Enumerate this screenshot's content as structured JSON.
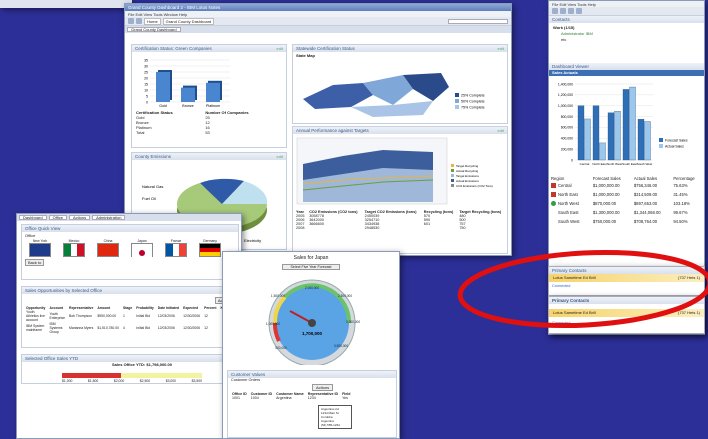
{
  "win_main": {
    "title": "Grand County Dashboard 2 - IBM Lotus Notes",
    "menu": "File  Edit  View  Tools  Window  Help",
    "tabs": [
      "Home",
      "Grand County Dashboard"
    ],
    "dashboard_tab": "Grand County Dashboard",
    "cert": {
      "title": "Certification Status: Green Companies",
      "edit": "edit",
      "col1": "Certification Status",
      "col2": "Number Of Companies",
      "rows": [
        [
          "Gold",
          "25"
        ],
        [
          "Bronze",
          "12"
        ],
        [
          "Platinum",
          "16"
        ],
        [
          "Total",
          "53"
        ]
      ],
      "chart": {
        "type": "bar",
        "categories": [
          "Gold",
          "Bronze",
          "Platinum"
        ],
        "values": [
          25,
          12,
          16
        ],
        "ylim": [
          0,
          35
        ],
        "yticks": [
          "0",
          "5",
          "10",
          "15",
          "20",
          "25",
          "30",
          "35"
        ]
      }
    },
    "state": {
      "title": "Statewide Certification Status",
      "edit": "edit",
      "map_label": "State Map",
      "legend": [
        "25% Complete",
        "50% Complete",
        "75% Complete"
      ]
    },
    "emissions": {
      "title": "County Emissions",
      "edit": "edit",
      "slices": [
        "Natural Gas",
        "Fuel Oil",
        "Electricity"
      ]
    },
    "targets": {
      "title": "Annual Performance against Targets",
      "edit": "edit",
      "legend": [
        "Target Recycling",
        "Actual Recycling",
        "Target Emissions",
        "Actual Emissions",
        "CO2 Emissions (CO2 Tons)"
      ],
      "cols": [
        "Year",
        "CO2 Emissions (CO2 tons)",
        "Target CO2 Emissions (tons)",
        "Recycling (tons)",
        "Target Recycling (tons)"
      ],
      "rows": [
        [
          "2005",
          "3058778",
          "2450039",
          "570",
          "480"
        ],
        [
          "2006",
          "3642000",
          "3254710",
          "590",
          "500"
        ],
        [
          "2007",
          "3666600",
          "3434938",
          "601",
          "757"
        ],
        [
          "2008",
          "",
          "2948530",
          "",
          "750"
        ]
      ]
    }
  },
  "win_left": {
    "tabs": [
      "Dashboard",
      "Office",
      "Actions",
      "Administration"
    ],
    "office": {
      "title": "Office Quick View",
      "label": "Office",
      "flags": [
        "New York",
        "Mexico",
        "China",
        "Japan",
        "France",
        "Germany"
      ],
      "button": "Back to"
    },
    "opps": {
      "title": "Sales Opportunities by Selected Office",
      "actions": "Actions",
      "cols": [
        "Opportunity",
        "Account",
        "Representative",
        "Amount",
        "Stage",
        "Probability",
        "Date Initiated",
        "Expected",
        "Percent",
        "Key Rank"
      ],
      "rows": [
        [
          "Youth Athletics live account",
          "Youth Enterprise",
          "Bob Thompson",
          "$950,000.00",
          "1",
          "Initial Bid",
          "12/03/2006",
          "12/30/2006",
          "12",
          ""
        ],
        [
          "IBM System mainframe",
          "IBM Systems Group",
          "Marianna Myers",
          "$1,510,780.00",
          "4",
          "Initial Bid",
          "12/03/2006",
          "12/30/2006",
          "12",
          ""
        ]
      ]
    },
    "selected": {
      "title": "Selected Office Sales YTD",
      "bar_title": "Sales Office YTD: $1,798,000.00",
      "scale": [
        "$1,000",
        "$1,500",
        "$2,000",
        "$2,500",
        "$3,000",
        "$3,500"
      ]
    }
  },
  "win_gauge": {
    "title": "Sales for Japan",
    "button": "Select Five Year Forecast",
    "value": "1,700,000",
    "ticks": [
      "2,000,000",
      "2,500,000",
      "3,000,000",
      "3,500,000",
      "1,500,000",
      "1,000,000",
      "500,000"
    ],
    "customer": {
      "title": "Customer Values",
      "subtitle": "Customer Orders",
      "actions": "Actions",
      "cols": [
        "Office ID",
        "Customer ID",
        "Customer Name",
        "Representative ID",
        "Field"
      ],
      "row": [
        "1001",
        "1004",
        "Argentina",
        "1234",
        "Yes"
      ],
      "popup": [
        "Argentina Ltd",
        "1234 Main St",
        "Cordoba",
        "Argentina",
        "(54) 555-1234"
      ]
    }
  },
  "win_right": {
    "menu": "File  Edit  View  Tools  Help",
    "contacts": {
      "title": "Contacts",
      "item": "Work (1/15)",
      "sub": "Administrator IBM",
      "sub2": "etc"
    },
    "viewer": {
      "title": "Dashboard Viewer",
      "panel": "Sales Actuals"
    },
    "chart_data": {
      "type": "bar",
      "categories": [
        "Central",
        "North East",
        "North West",
        "South East",
        "South West"
      ],
      "series": [
        {
          "name": "Forecast Sales",
          "values": [
            1000000,
            1000000,
            870000,
            1300000,
            750000
          ]
        },
        {
          "name": "Actual Sales",
          "values": [
            756346,
            314509,
            897653,
            1344068,
            708764
          ]
        }
      ],
      "ylim": [
        0,
        1400000
      ],
      "yticks": [
        "0",
        "200,000",
        "400,000",
        "600,000",
        "800,000",
        "1,000,000",
        "1,200,000",
        "1,400,000"
      ]
    },
    "table": {
      "cols": [
        "Region",
        "Forecast Sales",
        "Actual Sales",
        "Percentage"
      ],
      "rows": [
        [
          "Central",
          "$1,000,000.00",
          "$756,346.00",
          "75.63%"
        ],
        [
          "North East",
          "$1,000,000.00",
          "$314,509.00",
          "31.45%"
        ],
        [
          "North West",
          "$870,000.00",
          "$897,653.00",
          "103.18%"
        ],
        [
          "South East",
          "$1,300,000.00",
          "$1,344,068.00",
          "99.67%"
        ],
        [
          "South West",
          "$750,000.00",
          "$708,764.00",
          "94.50%"
        ]
      ],
      "colors": [
        "#c0392b",
        "#c0392b",
        "#2ea043",
        "#ffffff",
        "#ffffff"
      ]
    },
    "primary1": {
      "title": "Primary Contacts",
      "name": "Lotus Sametime Ed Brill",
      "note": "(737 Hets 1)",
      "footer": "Connected"
    },
    "primary2": {
      "title": "Primary Contacts",
      "name": "Lotus Sametime Ed Brill",
      "note": "(737 Hets 1)",
      "footer": "Connected"
    }
  },
  "colors": {
    "desktop": "#2c2f97",
    "ellipse": "#e01010",
    "bar_primary": "#2f6fb7",
    "bar_secondary": "#9cc7ec",
    "gauge_face": "#5aa4e6"
  }
}
